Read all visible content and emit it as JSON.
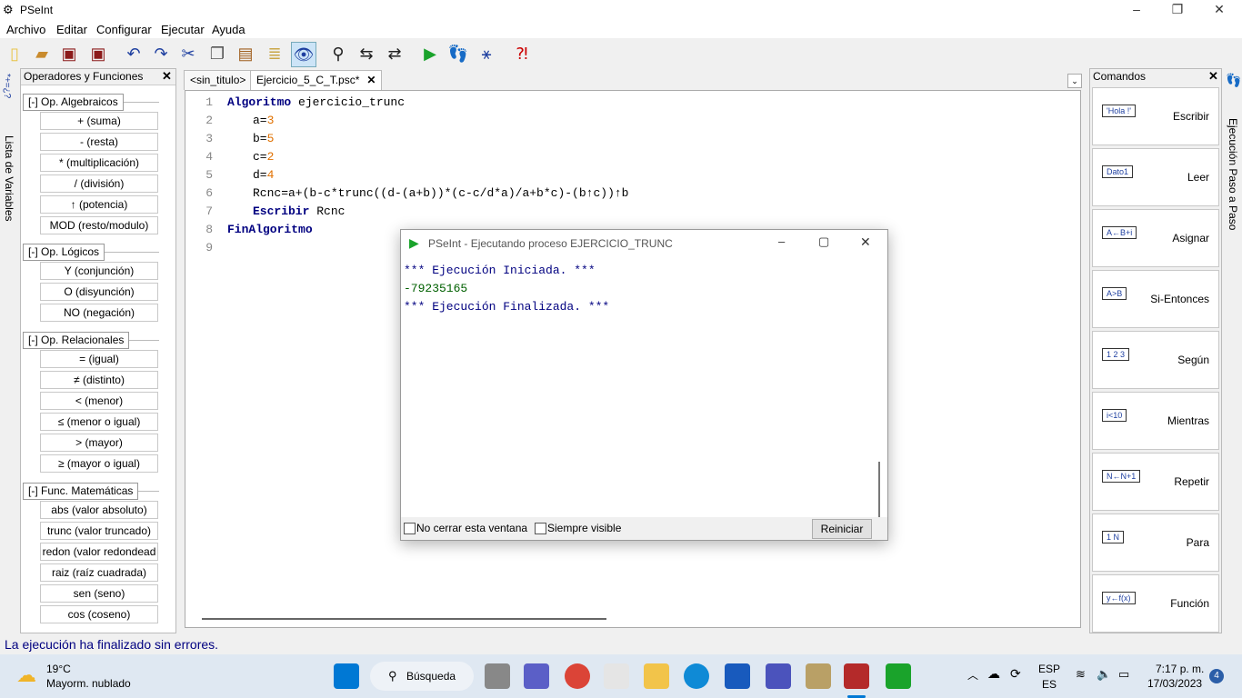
{
  "window": {
    "title": "PSeInt"
  },
  "menu": [
    "Archivo",
    "Editar",
    "Configurar",
    "Ejecutar",
    "Ayuda"
  ],
  "left_vertical_tab": {
    "label": "Lista de Variables",
    "symbols": "*+=¿?"
  },
  "ops_panel": {
    "title": "Operadores y Funciones",
    "groups": [
      {
        "label": "[-]  Op. Algebraicos",
        "items": [
          "+ (suma)",
          "- (resta)",
          "* (multiplicación)",
          "/ (división)",
          "↑ (potencia)",
          "MOD (resto/modulo)"
        ]
      },
      {
        "label": "[-]  Op. Lógicos",
        "items": [
          "Y (conjunción)",
          "O (disyunción)",
          "NO (negación)"
        ]
      },
      {
        "label": "[-]  Op. Relacionales",
        "items": [
          "= (igual)",
          "≠ (distinto)",
          "< (menor)",
          "≤ (menor o igual)",
          "> (mayor)",
          "≥ (mayor o igual)"
        ]
      },
      {
        "label": "[-]  Func. Matemáticas",
        "items": [
          "abs (valor absoluto)",
          "trunc (valor truncado)",
          "redon (valor redondead",
          "raiz (raíz cuadrada)",
          "sen (seno)",
          "cos (coseno)"
        ]
      }
    ]
  },
  "editor": {
    "tabs": [
      "<sin_titulo>",
      "Ejercicio_5_C_T.psc*"
    ],
    "line_numbers": [
      "1",
      "2",
      "3",
      "4",
      "5",
      "6",
      "7",
      "8",
      "9"
    ],
    "code": {
      "l1_kw": "Algoritmo",
      "l1_rest": " ejercicio_trunc",
      "l2_var": "a=",
      "l2_num": "3",
      "l3_var": "b=",
      "l3_num": "5",
      "l4_var": "c=",
      "l4_num": "2",
      "l5_var": "d=",
      "l5_num": "4",
      "l6": "Rcnc=a+(b-c*trunc((d-(a+b))*(c-c/d*a)/a+b*c)-(b↑c))↑b",
      "l7_kw": "Escribir",
      "l7_rest": " Rcnc",
      "l8_kw": "FinAlgoritmo"
    }
  },
  "run_window": {
    "title": "PSeInt - Ejecutando proceso EJERCICIO_TRUNC",
    "output": [
      "*** Ejecución Iniciada. ***",
      "-79235165",
      "*** Ejecución Finalizada. ***"
    ],
    "no_close_label": "No cerrar esta ventana",
    "always_visible_label": "Siempre visible",
    "restart_label": "Reiniciar"
  },
  "commands_panel": {
    "title": "Comandos",
    "items": [
      {
        "label": "Escribir",
        "icon_text": "'Hola !'"
      },
      {
        "label": "Leer",
        "icon_text": "Dato1"
      },
      {
        "label": "Asignar",
        "icon_text": "A←B+i"
      },
      {
        "label": "Si-Entonces",
        "icon_text": "A>B"
      },
      {
        "label": "Según",
        "icon_text": "1 2 3"
      },
      {
        "label": "Mientras",
        "icon_text": "i<10"
      },
      {
        "label": "Repetir",
        "icon_text": "N←N+1"
      },
      {
        "label": "Para",
        "icon_text": "1 N"
      },
      {
        "label": "Función",
        "icon_text": "y←f(x)"
      }
    ]
  },
  "right_vertical_tab": {
    "label": "Ejecución Paso a Paso"
  },
  "status": {
    "text": "La ejecución ha finalizado sin errores."
  },
  "taskbar": {
    "weather_temp": "19°C",
    "weather_desc": "Mayorm. nublado",
    "search_label": "Búsqueda",
    "lang_top": "ESP",
    "lang_bottom": "ES",
    "time": "7:17 p. m.",
    "date": "17/03/2023",
    "notifications": "4"
  },
  "colors": {
    "accent": "#0078d4",
    "keyword": "#000080",
    "number": "#e07000",
    "status": "#000080"
  }
}
